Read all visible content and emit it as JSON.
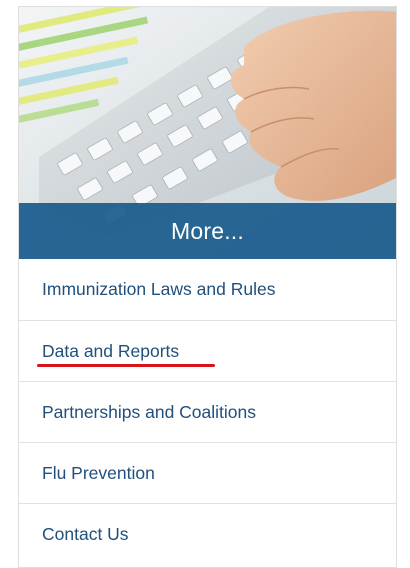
{
  "banner": {
    "title": "More..."
  },
  "menu": {
    "items": [
      {
        "label": "Immunization Laws and Rules"
      },
      {
        "label": "Data and Reports",
        "highlighted": true
      },
      {
        "label": "Partnerships and Coalitions"
      },
      {
        "label": "Flu Prevention"
      },
      {
        "label": "Contact Us"
      }
    ]
  },
  "colors": {
    "banner_bg": "#185a8c",
    "link": "#21507d",
    "highlight_underline": "#d8141b",
    "divider": "#e2e2e2"
  }
}
